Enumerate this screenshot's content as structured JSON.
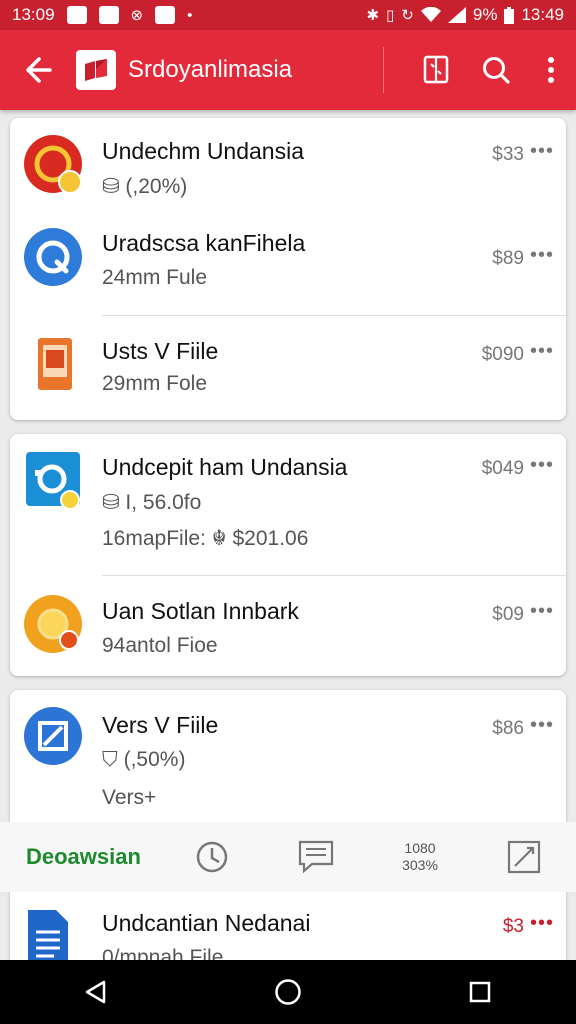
{
  "status_bar": {
    "left_time": "13:09",
    "right_text": "9%",
    "right_time": "13:49"
  },
  "app_bar": {
    "title": "Srdoyanlimasia",
    "icons": [
      "back-arrow-icon",
      "book-icon",
      "search-icon",
      "more-vert-icon"
    ]
  },
  "items": [
    {
      "title": "Undechm Undansia",
      "sub": "⛁ (,20%)",
      "price": "$33",
      "icon": "red-circle-badge-icon",
      "color": "#d92a22"
    },
    {
      "title": "Uradscsa kanFihela",
      "sub": "24mm Fule",
      "price": "$89",
      "icon": "blue-circle-icon",
      "color": "#2f7bd9"
    },
    {
      "title": "Usts V Fiile",
      "sub": "29mm Fole",
      "price": "$090",
      "icon": "orange-document-icon",
      "color": "#e8752b"
    },
    {
      "title": "Undcepit ham Undansia",
      "sub": "⛁ I, 56.0fo",
      "sub2": "16mapFile: ☬ $201.06",
      "price": "$049",
      "icon": "blue-camera-icon",
      "color": "#1b8fd6"
    },
    {
      "title": "Uan Sotlan Innbark",
      "sub": "94antol Fioe",
      "price": "$09",
      "icon": "orange-circle-icon",
      "color": "#f0a21e"
    },
    {
      "title": "Vers V Fiile",
      "sub": "⛉ (,50%)",
      "sub2": "Vers+",
      "price": "$86",
      "icon": "blue-edit-icon",
      "color": "#2c75d6"
    },
    {
      "title": "Undcantian Nedanai",
      "sub": "0/mpnah File",
      "price": "$3",
      "icon": "blue-file-icon",
      "color": "#2166c9",
      "price_color": "#c8202e"
    }
  ],
  "tab_bar": {
    "label": "Deoawsian",
    "stat_top": "1080",
    "stat_bottom": "303%"
  },
  "colors": {
    "primary": "#e22a3a",
    "status": "#c8202e",
    "accent_green": "#1e8a2e"
  }
}
